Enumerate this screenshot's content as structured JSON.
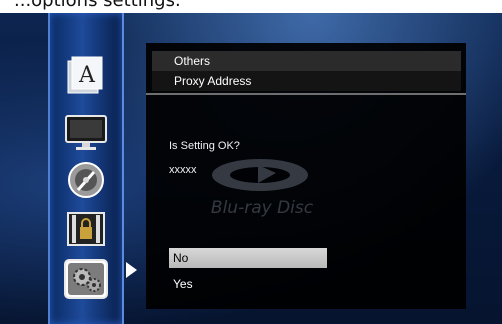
{
  "top_text": "...options settings.",
  "side_menu": {
    "icons": [
      "language-icon",
      "display-icon",
      "audio-icon",
      "parental-lock-icon",
      "settings-gear-icon"
    ],
    "language_glyph": "A"
  },
  "panel": {
    "header_row1": "Others",
    "header_row2": "Proxy Address",
    "question": "Is Setting OK?",
    "value": "xxxxx",
    "watermark": "Blu-ray Disc",
    "options": [
      "No",
      "Yes"
    ],
    "selected_option": "No"
  },
  "colors": {
    "background": "#081a3c",
    "rail": "#1f4b9a",
    "panel": "#000000",
    "selection": "#c8c8c8"
  }
}
